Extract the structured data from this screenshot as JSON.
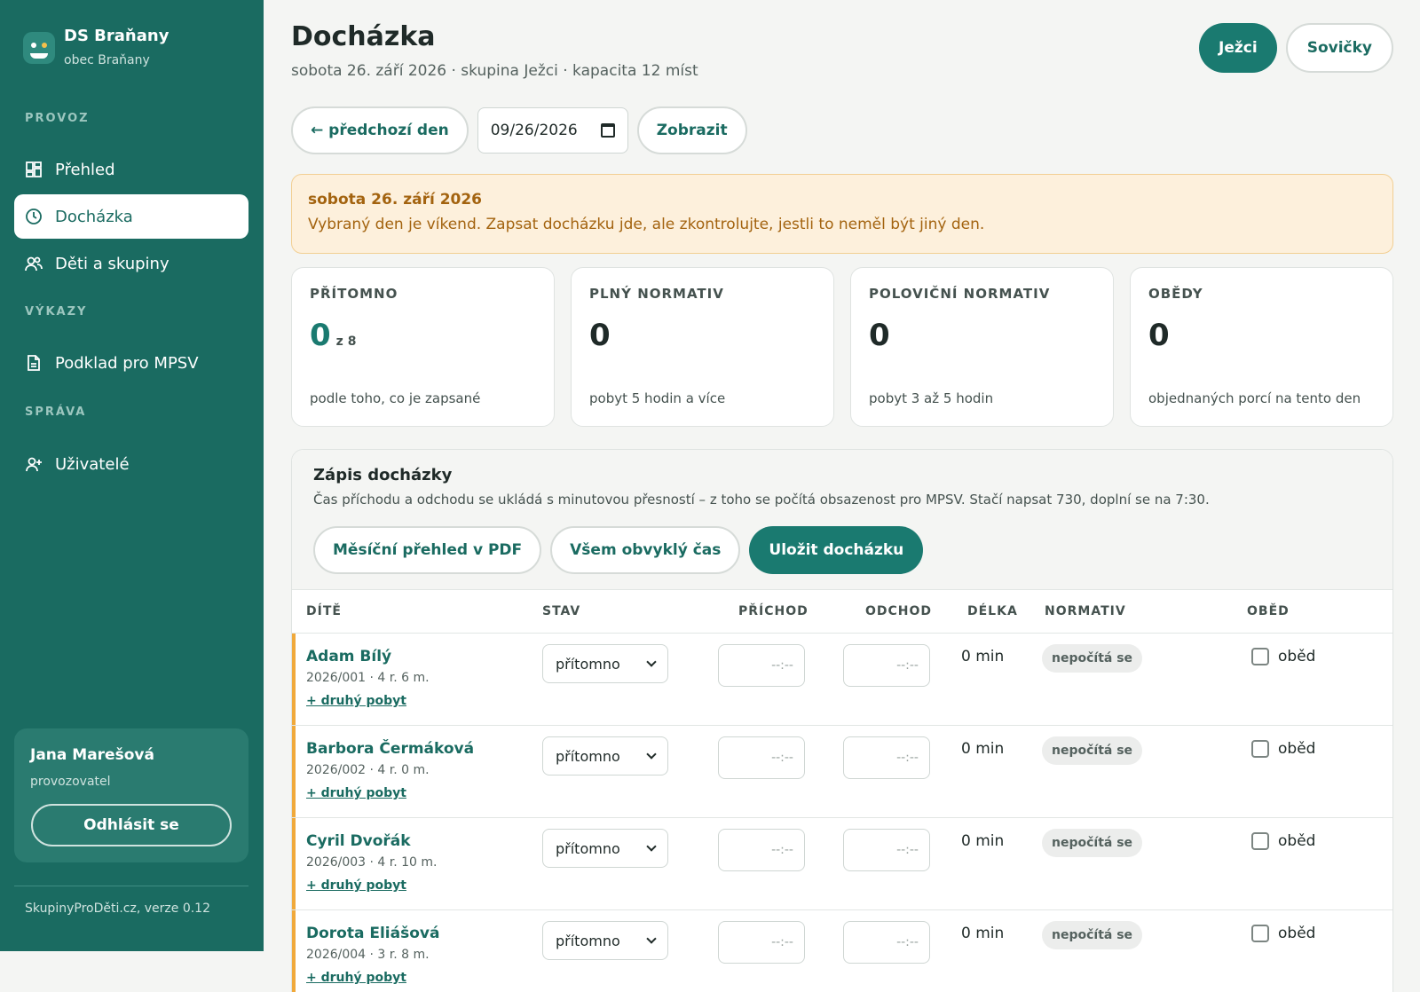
{
  "brand": {
    "name": "DS Braňany",
    "sub": "obec Braňany"
  },
  "nav": {
    "sections": [
      "PROVOZ",
      "VÝKAZY",
      "SPRÁVA"
    ],
    "items": [
      {
        "label": "Přehled",
        "icon": "dashboard-icon"
      },
      {
        "label": "Docházka",
        "icon": "clock-icon",
        "active": true
      },
      {
        "label": "Děti a skupiny",
        "icon": "users-icon"
      },
      {
        "label": "Podklad pro MPSV",
        "icon": "document-icon"
      },
      {
        "label": "Uživatelé",
        "icon": "user-plus-icon"
      }
    ]
  },
  "user": {
    "name": "Jana Marešová",
    "role": "provozovatel",
    "logout": "Odhlásit se"
  },
  "footer": "SkupinyProDěti.cz, verze 0.12",
  "header": {
    "title": "Docházka",
    "subtitle": "sobota 26. září 2026 · skupina Ježci · kapacita 12 míst",
    "groups": [
      "Ježci",
      "Sovičky"
    ]
  },
  "toolbar": {
    "prev": "← předchozí den",
    "date": "09/26/2026",
    "show": "Zobrazit"
  },
  "alert": {
    "title": "sobota 26. září 2026",
    "text": "Vybraný den je víkend. Zapsat docházku jde, ale zkontrolujte, jestli to neměl být jiný den."
  },
  "stats": [
    {
      "label": "PŘÍTOMNO",
      "value": "0",
      "of": "z 8",
      "note": "podle toho, co je zapsané"
    },
    {
      "label": "PLNÝ NORMATIV",
      "value": "0",
      "note": "pobyt 5 hodin a více"
    },
    {
      "label": "POLOVIČNÍ NORMATIV",
      "value": "0",
      "note": "pobyt 3 až 5 hodin"
    },
    {
      "label": "OBĚDY",
      "value": "0",
      "note": "objednaných porcí na tento den"
    }
  ],
  "panel": {
    "title": "Zápis docházky",
    "desc": "Čas příchodu a odchodu se ukládá s minutovou přesností – z toho se počítá obsazenost pro MPSV. Stačí napsat 730, doplní se na 7:30.",
    "actions": [
      "Měsíční přehled v PDF",
      "Všem obvyklý čas",
      "Uložit docházku"
    ],
    "columns": [
      "DÍTĚ",
      "STAV",
      "PŘÍCHOD",
      "ODCHOD",
      "DÉLKA",
      "NORMATIV",
      "OBĚD"
    ]
  },
  "rows": [
    {
      "name": "Adam Bílý",
      "meta": "2026/001 · 4 r. 6 m.",
      "link": "+ druhý pobyt",
      "status": "přítomno",
      "in": "--:--",
      "out": "--:--",
      "dur": "0 min",
      "norm": "nepočítá se",
      "lunch": "oběd"
    },
    {
      "name": "Barbora Čermáková",
      "meta": "2026/002 · 4 r. 0 m.",
      "link": "+ druhý pobyt",
      "status": "přítomno",
      "in": "--:--",
      "out": "--:--",
      "dur": "0 min",
      "norm": "nepočítá se",
      "lunch": "oběd"
    },
    {
      "name": "Cyril Dvořák",
      "meta": "2026/003 · 4 r. 10 m.",
      "link": "+ druhý pobyt",
      "status": "přítomno",
      "in": "--:--",
      "out": "--:--",
      "dur": "0 min",
      "norm": "nepočítá se",
      "lunch": "oběd"
    },
    {
      "name": "Dorota Eliášová",
      "meta": "2026/004 · 3 r. 8 m.",
      "link": "+ druhý pobyt",
      "status": "přítomno",
      "in": "--:--",
      "out": "--:--",
      "dur": "0 min",
      "norm": "nepočítá se",
      "lunch": "oběd"
    }
  ]
}
